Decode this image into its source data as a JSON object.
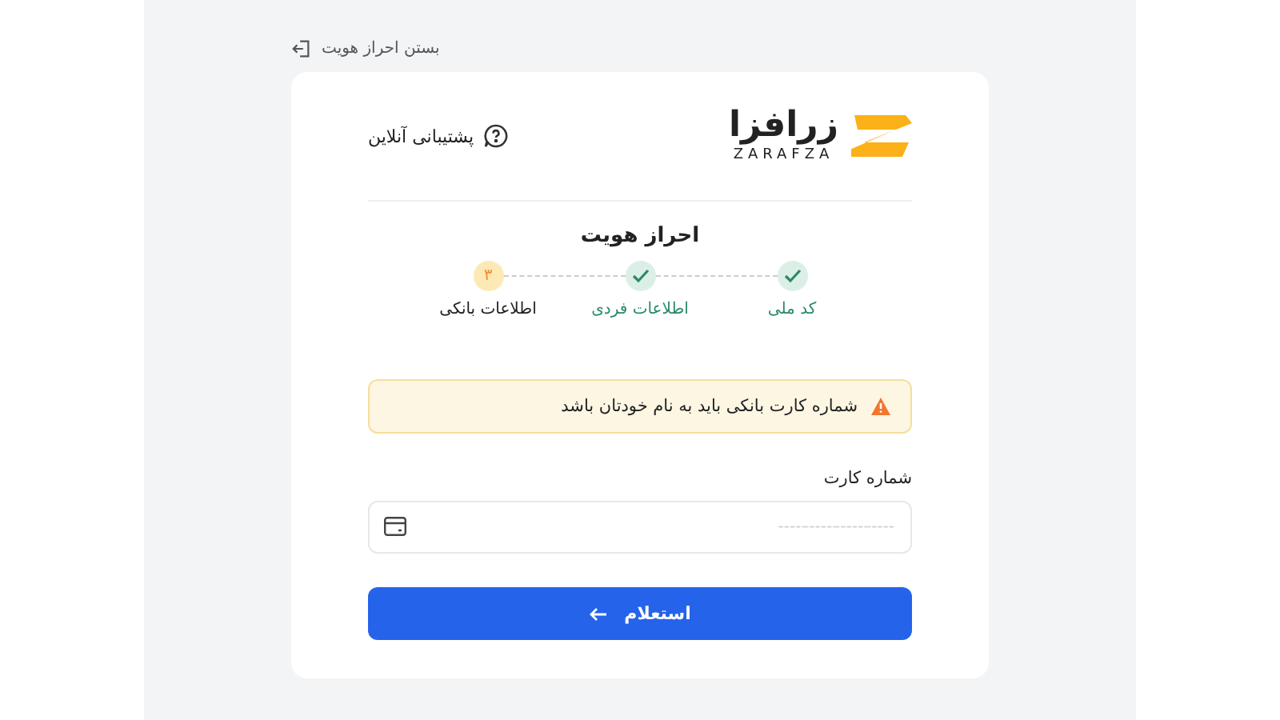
{
  "close_link": {
    "label": "بستن احراز هویت"
  },
  "logo": {
    "name": "زرافزا",
    "latin": "ZARAFZA"
  },
  "support": {
    "label": "پشتیبانی آنلاین"
  },
  "title": "احراز هویت",
  "steps": [
    {
      "label": "کد ملی",
      "done": true
    },
    {
      "label": "اطلاعات فردی",
      "done": true
    },
    {
      "label": "اطلاعات بانکی",
      "done": false,
      "number": "۳"
    }
  ],
  "alert": {
    "text": "شماره کارت بانکی باید به نام خودتان باشد"
  },
  "card_field": {
    "label": "شماره کارت",
    "placeholder": "----–----–----–----"
  },
  "submit": {
    "label": "استعلام"
  }
}
